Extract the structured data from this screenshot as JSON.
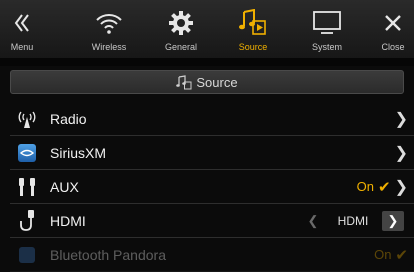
{
  "tabs": [
    {
      "label": "Menu",
      "icon": "chevron-double-left-icon"
    },
    {
      "label": "Wireless",
      "icon": "wifi-icon"
    },
    {
      "label": "General",
      "icon": "gear-icon"
    },
    {
      "label": "Source",
      "icon": "music-note-icon",
      "active": true
    },
    {
      "label": "System",
      "icon": "monitor-icon"
    },
    {
      "label": "Close",
      "icon": "close-icon"
    }
  ],
  "section": {
    "title": "Source",
    "icon": "music-note-icon"
  },
  "rows": [
    {
      "label": "Radio",
      "icon": "radio-antenna-icon"
    },
    {
      "label": "SiriusXM",
      "icon": "siriusxm-icon"
    },
    {
      "label": "AUX",
      "icon": "aux-plug-icon",
      "value": "On"
    },
    {
      "label": "HDMI",
      "icon": "hdmi-cable-icon",
      "value": "HDMI"
    },
    {
      "label": "Bluetooth Pandora",
      "icon": "pandora-icon",
      "value": "On"
    }
  ],
  "colors": {
    "accent": "#f0b000",
    "background": "#0b0b0b"
  }
}
